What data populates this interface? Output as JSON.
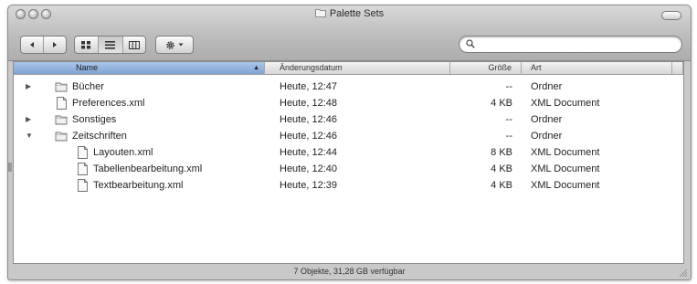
{
  "window": {
    "title": "Palette Sets"
  },
  "toolbar": {
    "back_icon": "back-arrow-icon",
    "forward_icon": "forward-arrow-icon",
    "view_icons": [
      "icon-view-icon",
      "list-view-icon",
      "column-view-icon"
    ],
    "action_icon": "gear-icon"
  },
  "search": {
    "value": "",
    "placeholder": ""
  },
  "columns": {
    "name": "Name",
    "date": "Änderungsdatum",
    "size": "Größe",
    "kind": "Art"
  },
  "rows": [
    {
      "name": "Bücher",
      "date": "Heute, 12:47",
      "size": "--",
      "kind": "Ordner",
      "type": "folder",
      "expanded": false,
      "level": 0
    },
    {
      "name": "Preferences.xml",
      "date": "Heute, 12:48",
      "size": "4 KB",
      "kind": "XML Document",
      "type": "file",
      "level": 0
    },
    {
      "name": "Sonstiges",
      "date": "Heute, 12:46",
      "size": "--",
      "kind": "Ordner",
      "type": "folder",
      "expanded": false,
      "level": 0
    },
    {
      "name": "Zeitschriften",
      "date": "Heute, 12:46",
      "size": "--",
      "kind": "Ordner",
      "type": "folder",
      "expanded": true,
      "level": 0
    },
    {
      "name": "Layouten.xml",
      "date": "Heute, 12:44",
      "size": "8 KB",
      "kind": "XML Document",
      "type": "file",
      "level": 1
    },
    {
      "name": "Tabellenbearbeitung.xml",
      "date": "Heute, 12:40",
      "size": "4 KB",
      "kind": "XML Document",
      "type": "file",
      "level": 1
    },
    {
      "name": "Textbearbeitung.xml",
      "date": "Heute, 12:39",
      "size": "4 KB",
      "kind": "XML Document",
      "type": "file",
      "level": 1
    }
  ],
  "status": {
    "text": "7 Objekte, 31,28 GB verfügbar"
  }
}
